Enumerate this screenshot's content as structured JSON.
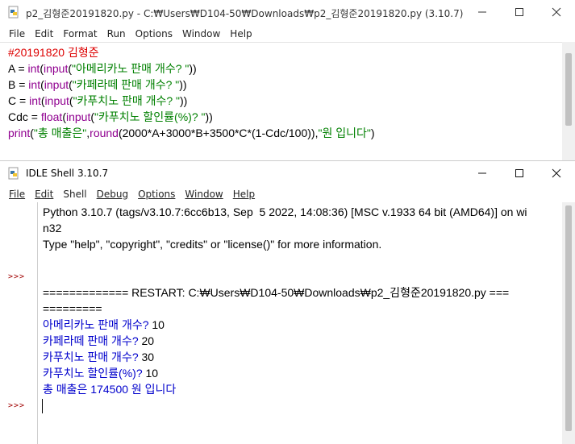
{
  "editor": {
    "title": "p2_김형준20191820.py - C:₩Users₩D104-50₩Downloads₩p2_김형준20191820.py (3.10.7)",
    "menu": [
      "File",
      "Edit",
      "Format",
      "Run",
      "Options",
      "Window",
      "Help"
    ],
    "comment": "#20191820 김형준",
    "lines": [
      {
        "a": "A = ",
        "f": "int",
        "b": "(",
        "g": "input",
        "c": "(",
        "s": "\"아메리카노 판매 개수? \"",
        "d": "))"
      },
      {
        "a": "B = ",
        "f": "int",
        "b": "(",
        "g": "input",
        "c": "(",
        "s": "\"카페라떼 판매 개수? \"",
        "d": "))"
      },
      {
        "a": "C = ",
        "f": "int",
        "b": "(",
        "g": "input",
        "c": "(",
        "s": "\"카푸치노 판매 개수? \"",
        "d": "))"
      },
      {
        "a": "Cdc = ",
        "f": "float",
        "b": "(",
        "g": "input",
        "c": "(",
        "s": "\"카푸치노 할인률(%)? \"",
        "d": "))"
      }
    ],
    "print_line": {
      "kw1": "print",
      "p1": "(",
      "s1": "\"총 매출은\"",
      "p2": ",",
      "kw2": "round",
      "expr": "(2000*A+3000*B+3500*C*(1-Cdc/100)),",
      "s2": "\"원 입니다\"",
      "p3": ")"
    }
  },
  "shell": {
    "title": "IDLE Shell 3.10.7",
    "menu": [
      "File",
      "Edit",
      "Shell",
      "Debug",
      "Options",
      "Window",
      "Help"
    ],
    "banner1": "Python 3.10.7 (tags/v3.10.7:6cc6b13, Sep  5 2022, 14:08:36) [MSC v.1933 64 bit (AMD64)] on wi",
    "banner2": "n32",
    "banner3": "Type \"help\", \"copyright\", \"credits\" or \"license()\" for more information.",
    "prompt": ">>>",
    "restart1": "============= RESTART: C:₩Users₩D104-50₩Downloads₩p2_김형준20191820.py ===",
    "restart2": "=========",
    "io": [
      {
        "q": "아메리카노 판매 개수? ",
        "a": "10"
      },
      {
        "q": "카페라떼 판매 개수? ",
        "a": "20"
      },
      {
        "q": "카푸치노 판매 개수? ",
        "a": "30"
      },
      {
        "q": "카푸치노 할인률(%)? ",
        "a": "10"
      }
    ],
    "result": "총 매출은 174500 원 입니다"
  },
  "colors": {
    "keyword": "#900090",
    "string": "#008000",
    "comment": "#dd0000",
    "output": "#0000cc",
    "prompt": "#a00000"
  }
}
